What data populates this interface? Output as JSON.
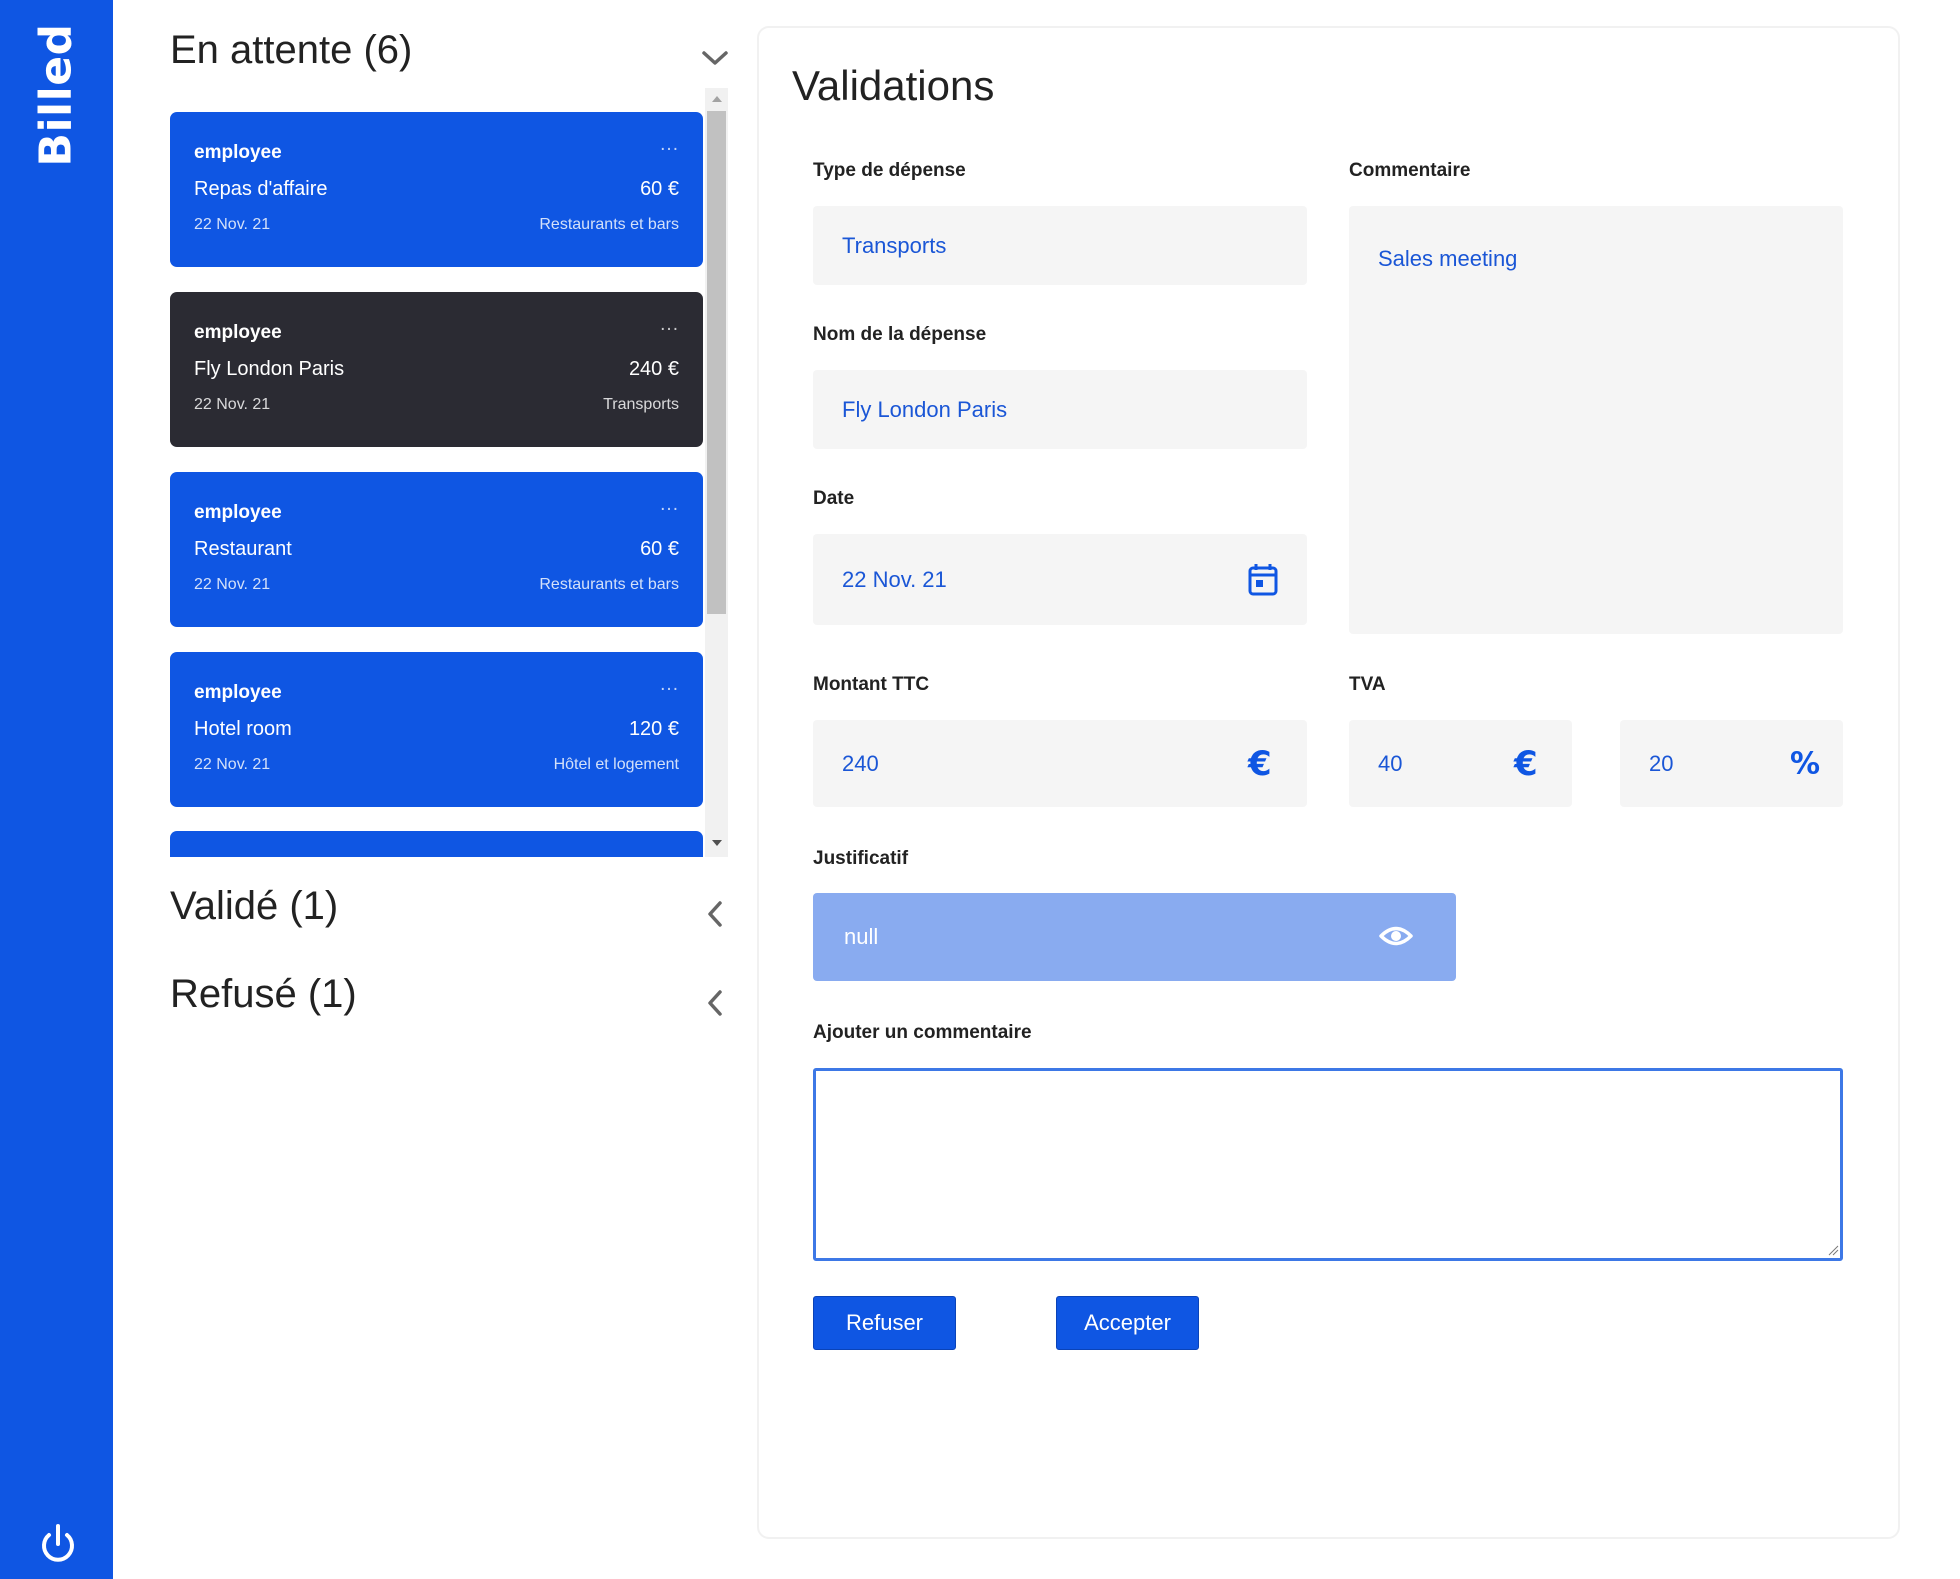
{
  "app": {
    "logo": "Billed"
  },
  "sections": {
    "pending": {
      "title": "En attente (6)"
    },
    "validated": {
      "title": "Validé (1)"
    },
    "refused": {
      "title": "Refusé (1)"
    }
  },
  "bills": [
    {
      "name": "employee",
      "dots": "...",
      "title": "Repas d'affaire",
      "amount": "60 €",
      "date": "22 Nov. 21",
      "type": "Restaurants et bars"
    },
    {
      "name": "employee",
      "dots": "...",
      "title": "Fly London Paris",
      "amount": "240 €",
      "date": "22 Nov. 21",
      "type": "Transports"
    },
    {
      "name": "employee",
      "dots": "...",
      "title": "Restaurant",
      "amount": "60 €",
      "date": "22 Nov. 21",
      "type": "Restaurants et bars"
    },
    {
      "name": "employee",
      "dots": "...",
      "title": "Hotel room",
      "amount": "120 €",
      "date": "22 Nov. 21",
      "type": "Hôtel et logement"
    }
  ],
  "validation": {
    "title": "Validations",
    "expense_type": {
      "label": "Type de dépense",
      "value": "Transports"
    },
    "expense_name": {
      "label": "Nom de la dépense",
      "value": "Fly London Paris"
    },
    "date": {
      "label": "Date",
      "value": "22 Nov. 21"
    },
    "comment": {
      "label": "Commentaire",
      "value": "Sales meeting"
    },
    "amount": {
      "label": "Montant TTC",
      "value": "240",
      "unit": "€"
    },
    "vat": {
      "label": "TVA",
      "value": "40",
      "unit": "€",
      "pct_value": "20",
      "pct_unit": "%"
    },
    "proof": {
      "label": "Justificatif",
      "value": "null"
    },
    "add_comment": {
      "label": "Ajouter un commentaire",
      "value": ""
    },
    "refuse_button": "Refuser",
    "accept_button": "Accepter"
  },
  "colors": {
    "primary": "#0f56e3",
    "selected_card": "#2b2b33",
    "proof_bg": "#89abf0"
  }
}
